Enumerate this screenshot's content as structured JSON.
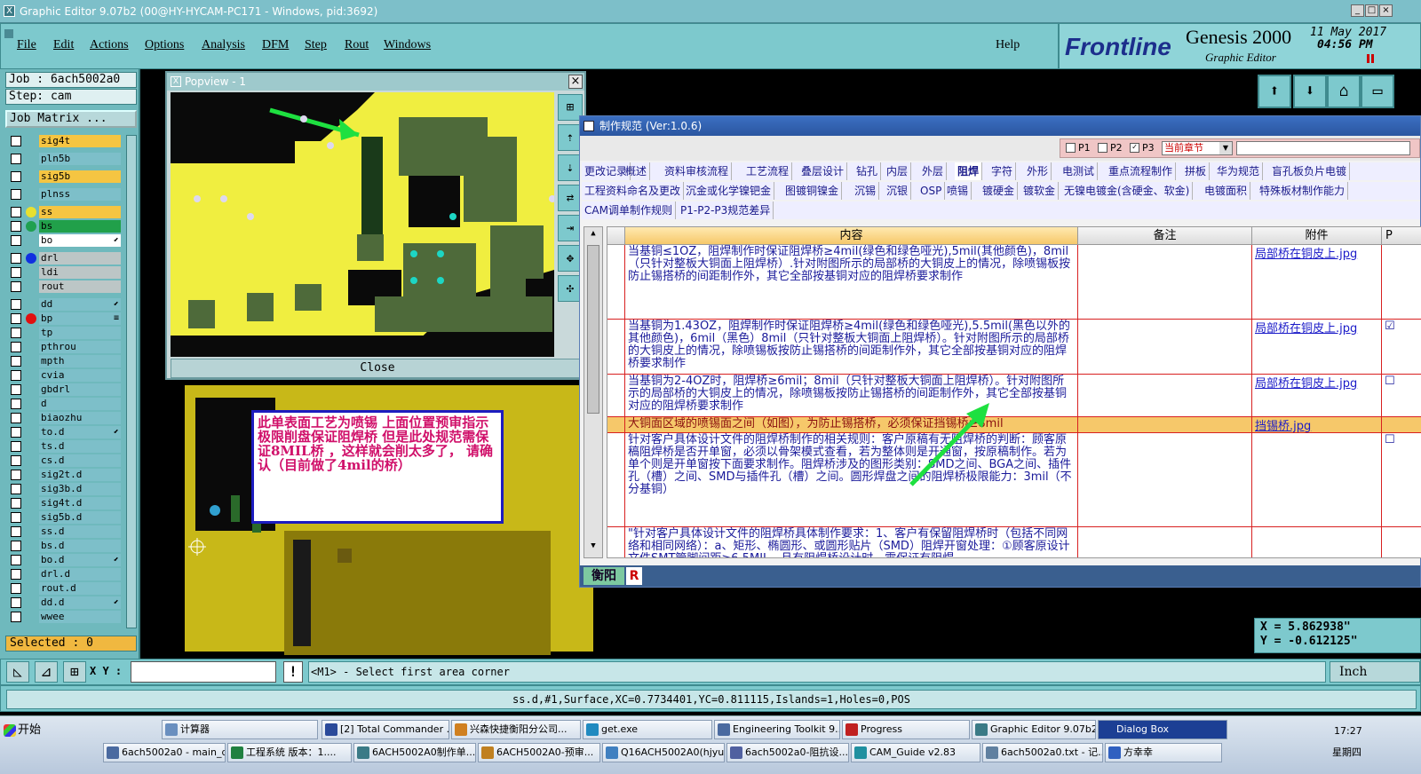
{
  "window": {
    "title": "Graphic Editor 9.07b2 (00@HY-HYCAM-PC171 - Windows, pid:3692)",
    "min": "_",
    "max": "□",
    "close": "×"
  },
  "menu": {
    "items": [
      "File",
      "Edit",
      "Actions",
      "Options",
      "Analysis",
      "DFM",
      "Step",
      "Rout",
      "Windows"
    ],
    "help": "Help"
  },
  "logo": {
    "brand": "Frontline",
    "product": "Genesis 2000",
    "subtitle": "Graphic Editor",
    "date": "11 May 2017",
    "time": "04:56 PM"
  },
  "left_panel": {
    "job_label": "Job : 6ach5002a0",
    "step_label": "Step: cam",
    "job_matrix": "Job Matrix ...",
    "selected": "Selected : 0",
    "layers": [
      {
        "name": "sig4t",
        "color": "y"
      },
      {
        "name": "pln5b",
        "color": "c"
      },
      {
        "name": "sig5b",
        "color": "y"
      },
      {
        "name": "plnss",
        "color": "c"
      },
      {
        "name": "ss",
        "color": "y",
        "dot": "#e8e030"
      },
      {
        "name": "bs",
        "color": "g2",
        "dot": "#20a050"
      },
      {
        "name": "bo",
        "color": "w",
        "flag": "⬋"
      },
      {
        "name": "drl",
        "color": "g",
        "dot": "#1030e0"
      },
      {
        "name": "ldi",
        "color": "g"
      },
      {
        "name": "rout",
        "color": "g"
      },
      {
        "name": "dd",
        "color": "c",
        "flag": "⬋"
      },
      {
        "name": "bp",
        "color": "c",
        "dot": "#e01010",
        "flag": "≡"
      },
      {
        "name": "tp",
        "color": "c"
      },
      {
        "name": "pthrou",
        "color": "c"
      },
      {
        "name": "mpth",
        "color": "c"
      },
      {
        "name": "cvia",
        "color": "c"
      },
      {
        "name": "gbdrl",
        "color": "c"
      },
      {
        "name": "d",
        "color": "c"
      },
      {
        "name": "biaozhu",
        "color": "c"
      },
      {
        "name": "to.d",
        "color": "c",
        "flag": "⬋"
      },
      {
        "name": "ts.d",
        "color": "c"
      },
      {
        "name": "cs.d",
        "color": "c"
      },
      {
        "name": "sig2t.d",
        "color": "c"
      },
      {
        "name": "sig3b.d",
        "color": "c"
      },
      {
        "name": "sig4t.d",
        "color": "c"
      },
      {
        "name": "sig5b.d",
        "color": "c"
      },
      {
        "name": "ss.d",
        "color": "c"
      },
      {
        "name": "bs.d",
        "color": "c"
      },
      {
        "name": "bo.d",
        "color": "c",
        "flag": "⬋"
      },
      {
        "name": "drl.d",
        "color": "c"
      },
      {
        "name": "rout.d",
        "color": "c"
      },
      {
        "name": "dd.d",
        "color": "c",
        "flag": "⬋"
      },
      {
        "name": "wwee",
        "color": "c"
      }
    ]
  },
  "popview": {
    "title": "Popview - 1",
    "close_label": "Close",
    "close_x": "×"
  },
  "note": {
    "text": "此单表面工艺为喷锡  上面位置预审指示极限削盘保证阻焊桥  但是此处规范需保证8MIL桥 ，这样就会削太多了， 请确认（目前做了4mil的桥）"
  },
  "spec": {
    "title": "制作规范 (Ver:1.0.6)",
    "p1": "P1",
    "p2": "P2",
    "p3": "P3",
    "chapter_select": "当前章节",
    "tabs_row1": [
      "更改记录",
      "概述",
      "资料审核流程",
      "工艺流程",
      "叠层设计",
      "钻孔",
      "内层",
      "外层",
      "阻焊",
      "字符",
      "外形",
      "电测试",
      "重点流程制作",
      "拼板",
      "华为规范",
      "盲孔板负片电镀"
    ],
    "tabs_row2": [
      "工程资料命名及更改",
      "沉金或化学镍钯金",
      "图镀铜镍金",
      "沉锡",
      "沉银",
      "OSP",
      "喷锡",
      "镀硬金",
      "镀软金",
      "无镍电镀金(含硬金、软金)",
      "电镀面积",
      "特殊板材制作能力"
    ],
    "tabs_row3": [
      "CAM调单制作规则",
      "P1-P2-P3规范差异"
    ],
    "active_tab": "阻焊",
    "columns": [
      "内容",
      "备注",
      "附件",
      "P"
    ],
    "rows": [
      {
        "content": "当基铜≤1OZ，阻焊制作时保证阻焊桥≥4mil(绿色和绿色哑光),5mil(其他颜色)，8mil（只针对整板大铜面上阻焊桥）.针对附图所示的局部桥的大铜皮上的情况，除喷锡板按防止锡搭桥的间距制作外，其它全部按基铜对应的阻焊桥要求制作",
        "note": "",
        "attach": "局部桥在铜皮上.jpg",
        "p": ""
      },
      {
        "content": "当基铜为1.43OZ，阻焊制作时保证阻焊桥≥4mil(绿色和绿色哑光),5.5mil(黑色以外的其他颜色)，6mil（黑色）8mil（只针对整板大铜面上阻焊桥）。针对附图所示的局部桥的大铜皮上的情况，除喷锡板按防止锡搭桥的间距制作外，其它全部按基铜对应的阻焊桥要求制作",
        "note": "",
        "attach": "局部桥在铜皮上.jpg",
        "p": "☑"
      },
      {
        "content": "当基铜为2-4OZ时，阻焊桥≥6mil；8mil（只针对整板大铜面上阻焊桥）。针对附图所示的局部桥的大铜皮上的情况，除喷锡板按防止锡搭桥的间距制作外，其它全部按基铜对应的阻焊桥要求制作",
        "note": "",
        "attach": "局部桥在铜皮上.jpg",
        "p": "☐"
      },
      {
        "content": "大铜面区域的喷锡面之间（如图），为防止锡搭桥，必须保证挡锡桥≥8mil",
        "note": "",
        "attach": "挡锡桥.jpg",
        "p": ""
      },
      {
        "content": "针对客户具体设计文件的阻焊桥制作的相关规则：客户原稿有无阻焊桥的判断：顾客原稿阻焊桥是否开单窗，必须以骨架模式查看，若为整体则是开通窗，按原稿制作。若为单个则是开单窗按下面要求制作。阻焊桥涉及的图形类别：SMD之间、BGA之间、插件孔（槽）之间、SMD与插件孔（槽）之间。圆形焊盘之间的阻焊桥极限能力：3mil（不分基铜）",
        "note": "",
        "attach": "",
        "p": "☐"
      },
      {
        "content": "\"针对客户具体设计文件的阻焊桥具体制作要求：1、客户有保留阻焊桥时（包括不同网络和相同网络）：a、矩形、椭圆形、或圆形贴片（SMD）阻焊开窗处理：①顾客原设计文件SMT管脚间距≥6.5MIL，且有阻焊桥设计时，需保证有阻焊",
        "note": "",
        "attach": "",
        "p": ""
      }
    ],
    "footer_user": "衡阳",
    "footer_r": "R"
  },
  "coords": {
    "x": "X =  5.862938\"",
    "y": "Y = -0.612125\""
  },
  "command": {
    "xy_label": "X Y :",
    "xy_value": "",
    "prompt": "<M1> - Select first area corner",
    "unit": "Inch"
  },
  "status": {
    "text": "ss.d,#1,Surface,XC=0.7734401,YC=0.811115,Islands=1,Holes=0,POS"
  },
  "taskbar": {
    "start": "开始",
    "row1": [
      "计算器",
      "[2] Total Commander ...",
      "兴森快捷衡阳分公司...",
      "get.exe",
      "Engineering Toolkit 9....",
      "Progress",
      "Graphic Editor 9.07b2 ...",
      "Dialog Box"
    ],
    "row2": [
      "6ach5002a0 - main_qa",
      "工程系统  版本：1....",
      "6ACH5002A0制作单...",
      "6ACH5002A0-预审...",
      "Q16ACH5002A0(hjyu...",
      "6ach5002a0-阻抗设...",
      "CAM_Guide v2.83",
      "6ach5002a0.txt - 记...",
      "方幸幸"
    ],
    "clock": "17:27",
    "weekday": "星期四"
  }
}
